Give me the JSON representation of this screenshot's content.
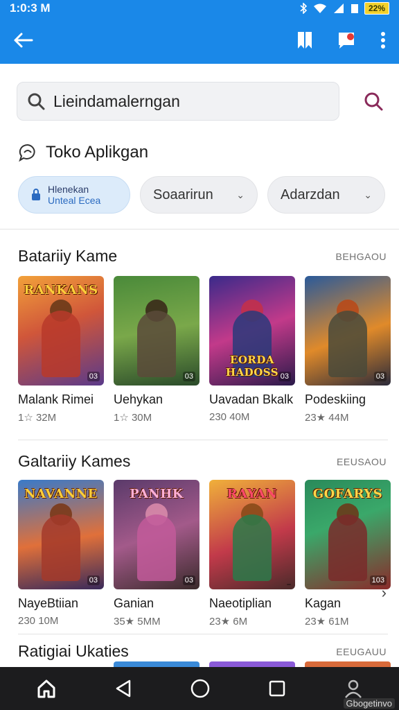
{
  "status_bar": {
    "time": "1:0:3 M",
    "battery": "22%"
  },
  "app_bar": {
    "back_icon": "arrow-left-icon",
    "bookmark_icon": "bookmark-icon",
    "notification_icon": "notification-icon",
    "menu_icon": "more-vert-icon"
  },
  "search": {
    "value": "Lieindamalerngan",
    "icon": "search-icon",
    "action_icon": "search-icon"
  },
  "store": {
    "title": "Toko Aplikgan",
    "icon": "chat-bubble-icon"
  },
  "chips": {
    "active": {
      "line1": "Hlenekan",
      "line2": "Unteal Ecea",
      "icon": "lock-icon"
    },
    "dropdown1": "Soaarirun",
    "dropdown2": "Adarzdan"
  },
  "sections": [
    {
      "title": "Batariiy Kame",
      "more": "BEHGAOU",
      "apps": [
        {
          "name": "Malank Rimei",
          "meta": "1☆ 32M",
          "logo": "RANKANS",
          "badge": "03"
        },
        {
          "name": "Uehykan",
          "meta": "1☆ 30M",
          "logo": "",
          "badge": "03"
        },
        {
          "name": "Uavadan Bkalk",
          "meta": "230 40M",
          "logo": "EORDA HADOSS",
          "badge": "03"
        },
        {
          "name": "Podeskiing",
          "meta": "23★ 44M",
          "logo": "",
          "badge": "03"
        }
      ]
    },
    {
      "title": "Galtariiy Kames",
      "more": "EEUSAOU",
      "apps": [
        {
          "name": "NayeBtiian",
          "meta": "230 10M",
          "logo": "NAVANNE",
          "badge": "03"
        },
        {
          "name": "Ganian",
          "meta": "35★ 5MM",
          "logo": "PANHK",
          "badge": "03"
        },
        {
          "name": "Naeotiplian",
          "meta": "23★ 6M",
          "logo": "RAYAN",
          "badge": ""
        },
        {
          "name": "Kagan",
          "meta": "23★ 61M",
          "logo": "GOFARYS",
          "badge": "103"
        }
      ]
    },
    {
      "title": "Ratigiai Ukaties",
      "more": "EEUGAUU"
    }
  ],
  "nav_bar": {
    "home": "home-icon",
    "back": "back-triangle-icon",
    "circle": "home-circle-icon",
    "recent": "recent-apps-icon",
    "profile": "profile-icon"
  },
  "watermark": "Gbogetinvo",
  "colors": {
    "app_bar": "#1a88e8",
    "nav_bar": "#1c1c1e",
    "accent": "#8a2a5a"
  }
}
